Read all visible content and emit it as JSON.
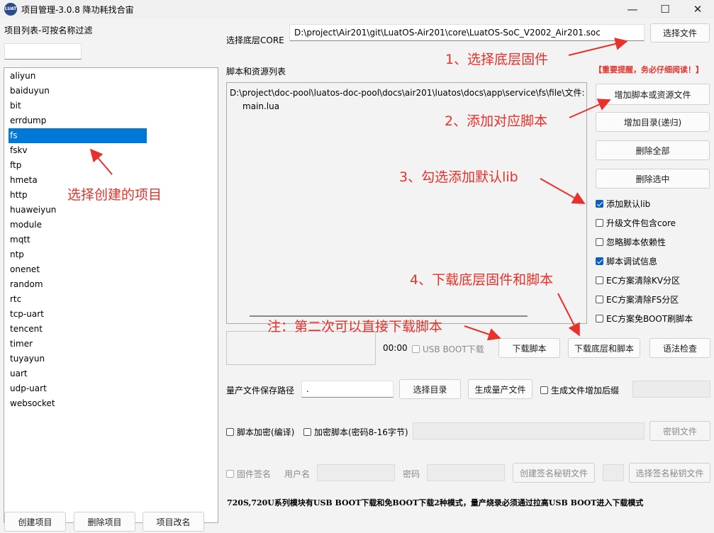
{
  "window": {
    "title": "项目管理-3.0.8 降功耗找合宙",
    "icon_text": "LUAT",
    "minimize": "—",
    "maximize": "☐",
    "close": "✕"
  },
  "sidebar": {
    "filter_label": "项目列表-可按名称过滤",
    "filter_value": "",
    "projects": [
      "aliyun",
      "baiduyun",
      "bit",
      "errdump",
      "fs",
      "fskv",
      "ftp",
      "hmeta",
      "http",
      "huaweiyun",
      "module",
      "mqtt",
      "ntp",
      "onenet",
      "random",
      "rtc",
      "tcp-uart",
      "tencent",
      "timer",
      "tuyayun",
      "uart",
      "udp-uart",
      "websocket"
    ],
    "selected": "fs",
    "buttons": {
      "create": "创建项目",
      "delete": "删除项目",
      "rename": "项目改名"
    }
  },
  "core": {
    "label": "选择底层CORE",
    "path": "D:\\project\\Air201\\git\\LuatOS-Air201\\core\\LuatOS-SoC_V2002_Air201.soc",
    "choose_button": "选择文件"
  },
  "scripts": {
    "label": "脚本和资源列表",
    "warning": "【重要提醒，务必仔细阅读！】",
    "folder": "D:\\project\\doc-pool\\luatos-doc-pool\\docs\\air201\\luatos\\docs\\app\\service\\fs\\file\\文件:",
    "files": [
      "main.lua"
    ],
    "buttons": {
      "add_file": "增加脚本或资源文件",
      "add_dir": "增加目录(递归)",
      "delete_all": "删除全部",
      "delete_selected": "删除选中"
    }
  },
  "options": [
    {
      "label": "添加默认lib",
      "checked": true
    },
    {
      "label": "升级文件包含core",
      "checked": false
    },
    {
      "label": "忽略脚本依赖性",
      "checked": false
    },
    {
      "label": "脚本调试信息",
      "checked": true
    },
    {
      "label": "EC方案清除KV分区",
      "checked": false
    },
    {
      "label": "EC方案清除FS分区",
      "checked": false
    },
    {
      "label": "EC方案免BOOT刷脚本",
      "checked": false
    }
  ],
  "download": {
    "timer": "00:00",
    "usb_boot": "USB BOOT下载",
    "download_script": "下载脚本",
    "download_all": "下载底层和脚本",
    "syntax_check": "语法检查"
  },
  "mass": {
    "path_label": "量产文件保存路径",
    "path_value": ".",
    "choose_dir": "选择目录",
    "generate": "生成量产文件",
    "suffix_label": "生成文件增加后缀",
    "suffix_value": ""
  },
  "encrypt": {
    "compile_label": "脚本加密(编译)",
    "password_label": "加密脚本(密码8-16字节)",
    "password_value": "",
    "key_file": "密钥文件"
  },
  "sign": {
    "label": "固件签名",
    "user_label": "用户名",
    "user_value": "",
    "pwd_label": "密码",
    "pwd_value": "",
    "create_key": "创建签名秘钥文件",
    "choose_key": "选择签名秘钥文件"
  },
  "footnote": "720S,720U系列模块有USB BOOT下载和免BOOT下载2种模式，量产烧录必须通过拉高USB BOOT进入下载模式",
  "annotations": {
    "select_project": "选择创建的项目",
    "step1": "1、选择底层固件",
    "step2": "2、添加对应脚本",
    "step3": "3、勾选添加默认lib",
    "step4": "4、下载底层固件和脚本",
    "note": "注：第二次可以直接下载脚本",
    "color": "#e8312a"
  }
}
